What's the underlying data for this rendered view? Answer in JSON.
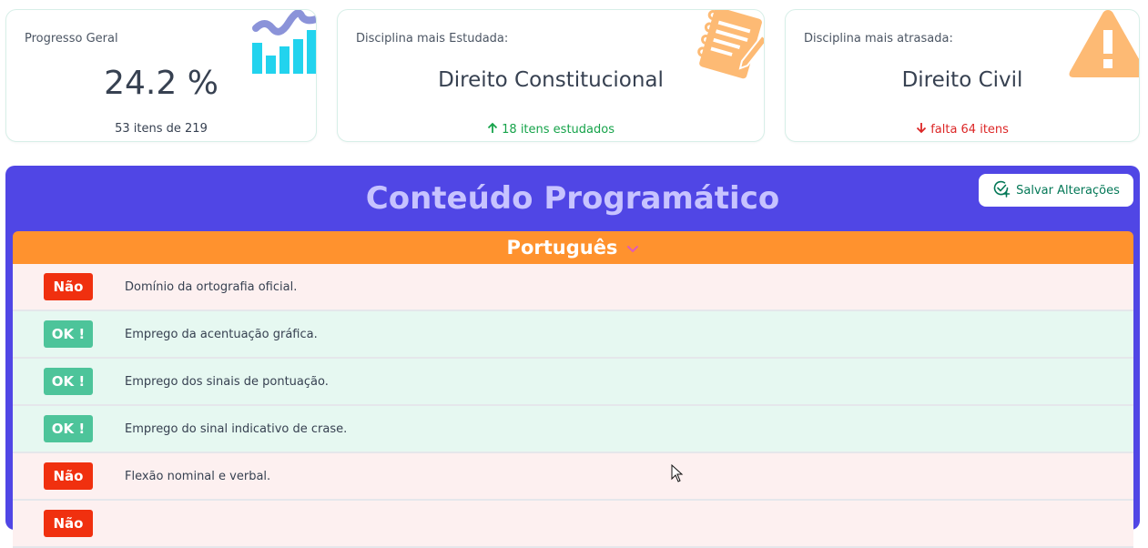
{
  "stats": {
    "progress": {
      "label": "Progresso Geral",
      "value": "24.2 %",
      "detail": "53 itens de 219",
      "icon": "bar-chart-icon",
      "progress_fraction": 0.242
    },
    "most_studied": {
      "label": "Disciplina mais Estudada:",
      "subject": "Direito Constitucional",
      "detail": "18 itens estudados",
      "icon": "notepad-icon"
    },
    "most_behind": {
      "label": "Disciplina mais atrasada:",
      "subject": "Direito Civil",
      "detail": "falta 64 itens",
      "icon": "warning-icon"
    }
  },
  "content": {
    "title": "Conteúdo Programático",
    "save_label": "Salvar Alterações",
    "subject": "Português",
    "items": [
      {
        "status": "Não",
        "text": "Domínio da ortografia oficial."
      },
      {
        "status": "OK !",
        "text": "Emprego da acentuação gráfica."
      },
      {
        "status": "OK !",
        "text": "Emprego dos sinais de pontuação."
      },
      {
        "status": "OK !",
        "text": "Emprego do sinal indicativo de crase."
      },
      {
        "status": "Não",
        "text": "Flexão nominal e verbal."
      },
      {
        "status": "Não",
        "text": ""
      }
    ]
  },
  "colors": {
    "panel": "#5046e5",
    "subject_bar": "#ff922e",
    "ok": "#4dc49a",
    "nao": "#f0300f",
    "up": "#16a34a",
    "down": "#dc2626",
    "icon_cyan": "#22d3ee",
    "icon_orange": "#fdba74"
  }
}
